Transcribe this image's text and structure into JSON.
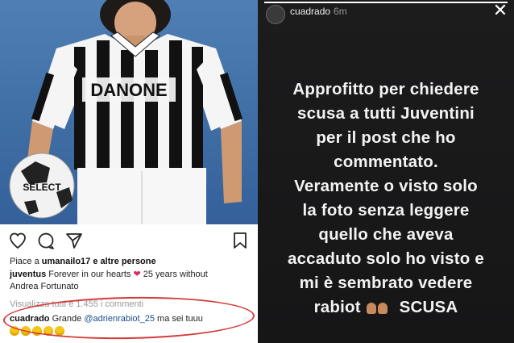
{
  "post": {
    "likes_prefix": "Piace a",
    "likes_user": "umanailo17",
    "likes_suffix": "e altre persone",
    "author": "juventus",
    "caption_text": "Forever in our hearts",
    "caption_after": "25 years without",
    "caption_line2": "Andrea Fortunato",
    "view_comments": "Visualizza tutti e 1.455 i commenti",
    "comment_author": "cuadrado",
    "comment_text_before": "Grande",
    "comment_mention": "@adrienrabiot_25",
    "comment_text_after": "ma sei tuuu",
    "jersey_text": "DANONE",
    "ball_text": "SELECT"
  },
  "story": {
    "username": "cuadrado",
    "time": "6m",
    "close_icon": "close-icon",
    "lines": [
      "Approfitto  per chiedere",
      "scusa a tutti   Juventini",
      "per il post che ho",
      "commentato.",
      "Veramente o visto solo",
      "la foto senza leggere",
      "quello che aveva",
      "accaduto  solo ho visto e",
      "mi è sembrato vedere",
      "rabiot",
      "SCUSA"
    ]
  },
  "colors": {
    "heart": "#e0245e",
    "circle": "#d53a3a",
    "mention": "#1b4d89"
  }
}
